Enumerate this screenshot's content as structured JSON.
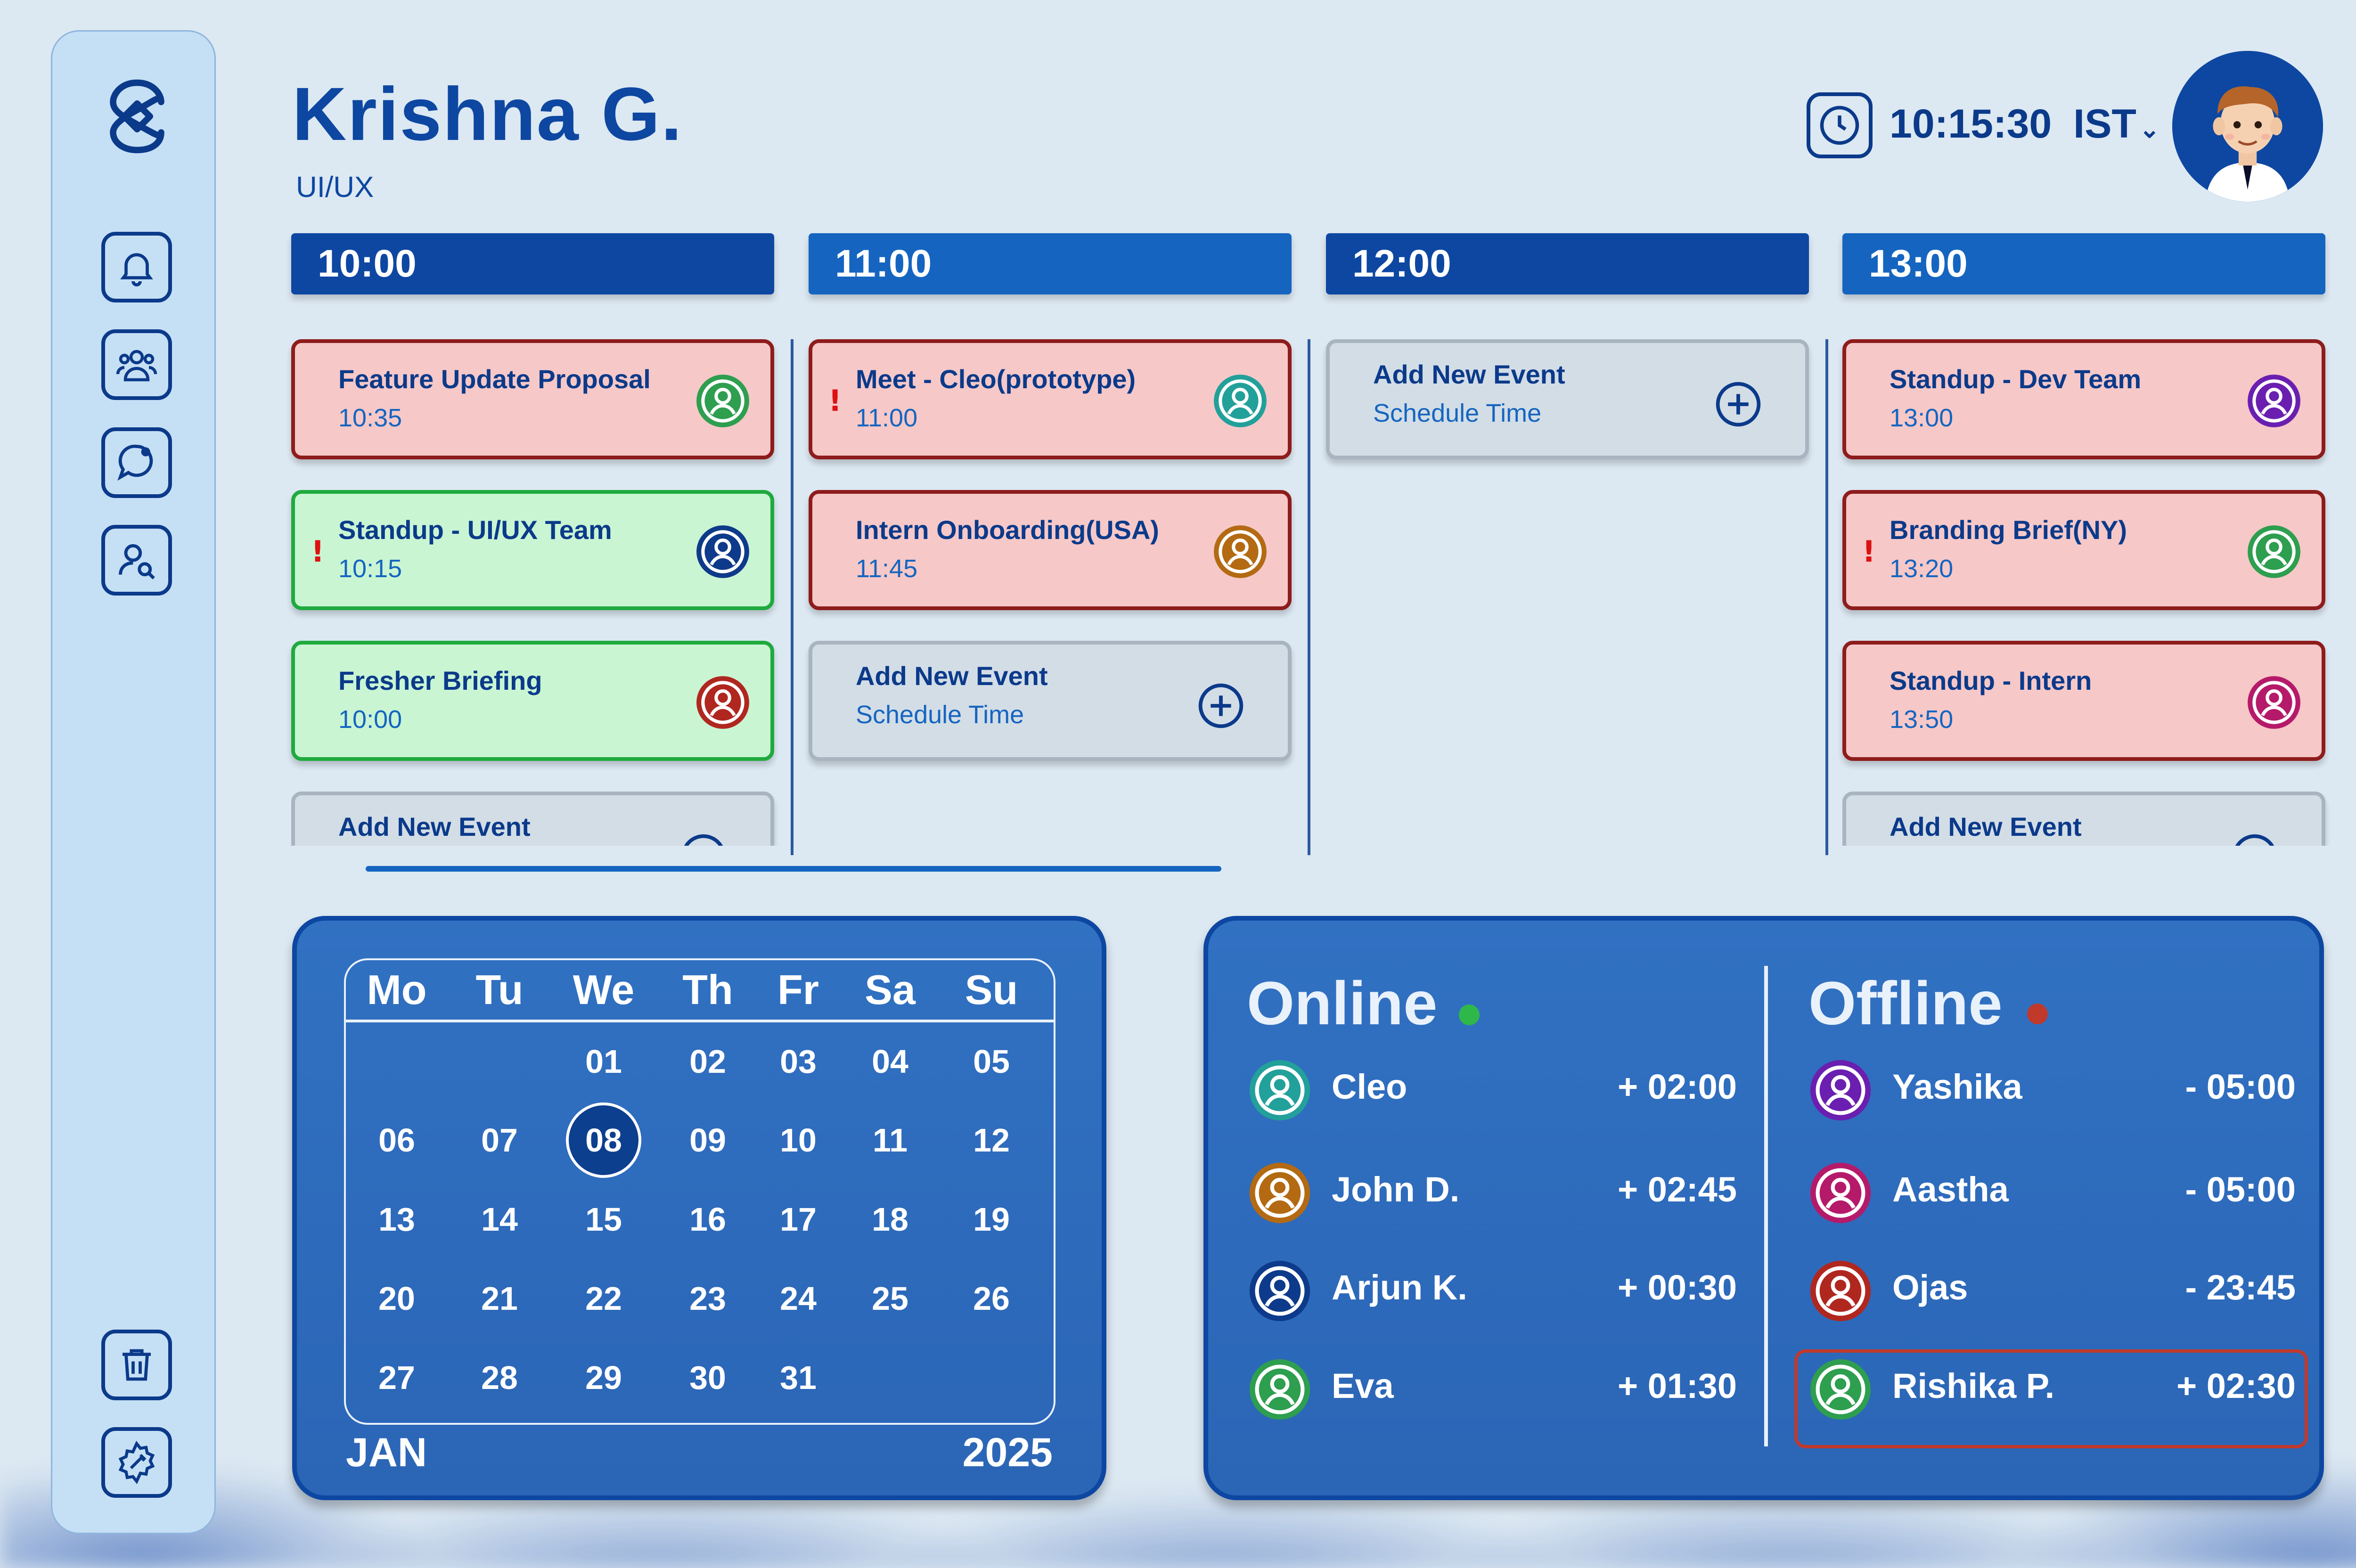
{
  "user": {
    "name": "Krishna G.",
    "role": "UI/UX"
  },
  "clock": {
    "time": "10:15:30",
    "zone": "IST"
  },
  "columns": [
    {
      "label": "10:00",
      "color": "#0d47a1",
      "events": [
        {
          "title": "Feature Update Proposal",
          "time": "10:35",
          "style": "red",
          "avatar_color": "#2e9e4f",
          "alert": false
        },
        {
          "title": "Standup - UI/UX Team",
          "time": "10:15",
          "style": "green",
          "avatar_color": "#0d3a8a",
          "alert": true
        },
        {
          "title": "Fresher Briefing",
          "time": "10:00",
          "style": "green",
          "avatar_color": "#b0271f",
          "alert": false
        },
        {
          "title": "Add New Event",
          "time": "",
          "style": "grey",
          "add": true
        }
      ]
    },
    {
      "label": "11:00",
      "color": "#1565c0",
      "events": [
        {
          "title": "Meet - Cleo(prototype)",
          "time": "11:00",
          "style": "red",
          "avatar_color": "#22a09a",
          "alert": true
        },
        {
          "title": "Intern Onboarding(USA)",
          "time": "11:45",
          "style": "red",
          "avatar_color": "#b36a12",
          "alert": false
        },
        {
          "title": "Add New Event",
          "time": "Schedule Time",
          "style": "grey",
          "add": true
        }
      ]
    },
    {
      "label": "12:00",
      "color": "#0d47a1",
      "events": [
        {
          "title": "Add New Event",
          "time": "Schedule Time",
          "style": "grey",
          "add": true
        }
      ]
    },
    {
      "label": "13:00",
      "color": "#1565c0",
      "events": [
        {
          "title": "Standup - Dev Team",
          "time": "13:00",
          "style": "red",
          "avatar_color": "#6a1fb0",
          "alert": false
        },
        {
          "title": "Branding Brief(NY)",
          "time": "13:20",
          "style": "red",
          "avatar_color": "#2e9e4f",
          "alert": true
        },
        {
          "title": "Standup - Intern",
          "time": "13:50",
          "style": "red",
          "avatar_color": "#b51a6a",
          "alert": false
        },
        {
          "title": "Add New Event",
          "time": "",
          "style": "grey",
          "add": true
        }
      ]
    }
  ],
  "calendar": {
    "month": "JAN",
    "year": "2025",
    "weekdays": [
      "Mo",
      "Tu",
      "We",
      "Th",
      "Fr",
      "Sa",
      "Su"
    ],
    "weeks": [
      [
        "",
        "",
        "01",
        "02",
        "03",
        "04",
        "05"
      ],
      [
        "06",
        "07",
        "08",
        "09",
        "10",
        "11",
        "12"
      ],
      [
        "13",
        "14",
        "15",
        "16",
        "17",
        "18",
        "19"
      ],
      [
        "20",
        "21",
        "22",
        "23",
        "24",
        "25",
        "26"
      ],
      [
        "27",
        "28",
        "29",
        "30",
        "31",
        "",
        ""
      ]
    ],
    "selected": "08"
  },
  "status": {
    "online_label": "Online",
    "offline_label": "Offline",
    "online_color": "#2fb84a",
    "offline_color": "#c0392b",
    "online": [
      {
        "name": "Cleo",
        "offset": "+ 02:00",
        "color": "#22a09a"
      },
      {
        "name": "John D.",
        "offset": "+ 02:45",
        "color": "#b36a12"
      },
      {
        "name": "Arjun K.",
        "offset": "+ 00:30",
        "color": "#0d3a8a"
      },
      {
        "name": "Eva",
        "offset": "+ 01:30",
        "color": "#2e9e4f"
      }
    ],
    "offline": [
      {
        "name": "Yashika",
        "offset": "- 05:00",
        "color": "#6a1fb0"
      },
      {
        "name": "Aastha",
        "offset": "- 05:00",
        "color": "#b51a6a"
      },
      {
        "name": "Ojas",
        "offset": "- 23:45",
        "color": "#b0271f"
      },
      {
        "name": "Rishika P.",
        "offset": "+ 02:30",
        "color": "#2e9e4f",
        "highlight": true
      }
    ]
  },
  "sidebar": {
    "items": [
      "bell-icon",
      "team-icon",
      "chat-icon",
      "user-search-icon"
    ],
    "bottom": [
      "trash-icon",
      "settings-icon"
    ]
  },
  "add_event": {
    "title": "Add New Event",
    "sub": "Schedule Time"
  }
}
